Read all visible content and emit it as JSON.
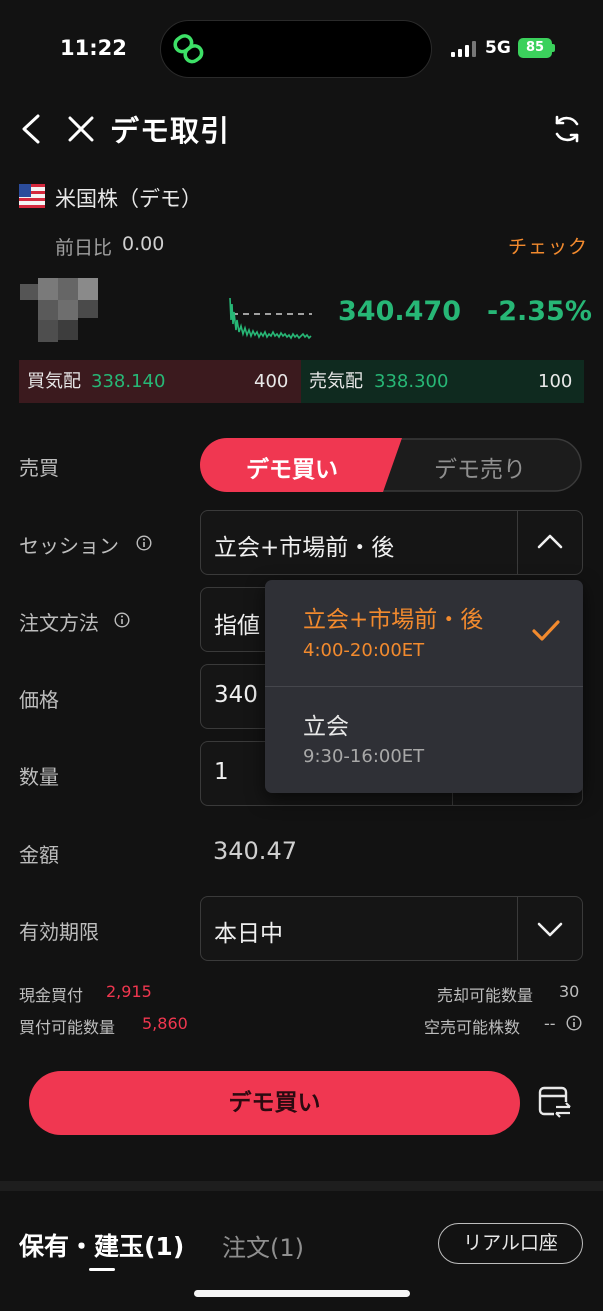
{
  "status_bar": {
    "time": "11:22",
    "network": "5G",
    "battery": "85"
  },
  "header": {
    "title": "デモ取引"
  },
  "market": {
    "name": "米国株（デモ）",
    "prev_day_label": "前日比",
    "prev_day_value": "0.00",
    "check_link": "チェック"
  },
  "quote": {
    "price": "340.470",
    "change_pct": "-2.35%",
    "bid_label": "買気配",
    "bid_price": "338.140",
    "bid_size": "400",
    "ask_label": "売気配",
    "ask_price": "338.300",
    "ask_size": "100"
  },
  "form": {
    "side_label": "売買",
    "buy_toggle": "デモ買い",
    "sell_toggle": "デモ売り",
    "session_label": "セッション",
    "session_value": "立会+市場前・後",
    "order_method_label": "注文方法",
    "order_method_value": "指値",
    "price_label": "価格",
    "price_value": "340",
    "qty_label": "数量",
    "qty_value": "1",
    "amount_label": "金額",
    "amount_value": "340.47",
    "expiry_label": "有効期限",
    "expiry_value": "本日中"
  },
  "session_dropdown": {
    "options": [
      {
        "title": "立会+市場前・後",
        "hours": "4:00-20:00ET",
        "selected": true
      },
      {
        "title": "立会",
        "hours": "9:30-16:00ET",
        "selected": false
      }
    ]
  },
  "stats": {
    "cash_buy_label": "現金買付",
    "cash_buy_value": "2,915",
    "buyable_qty_label": "買付可能数量",
    "buyable_qty_value": "5,860",
    "sellable_qty_label": "売却可能数量",
    "sellable_qty_value": "30",
    "short_qty_label": "空売可能株数",
    "short_qty_value": "--"
  },
  "action": {
    "buy_button": "デモ買い"
  },
  "bottom_tabs": {
    "holdings": "保有・建玉(1)",
    "orders": "注文(1)",
    "real_account": "リアル口座"
  },
  "colors": {
    "buy": "#f03751",
    "up_green": "#27b776",
    "accent_orange": "#f28a2e",
    "background": "#121212"
  }
}
